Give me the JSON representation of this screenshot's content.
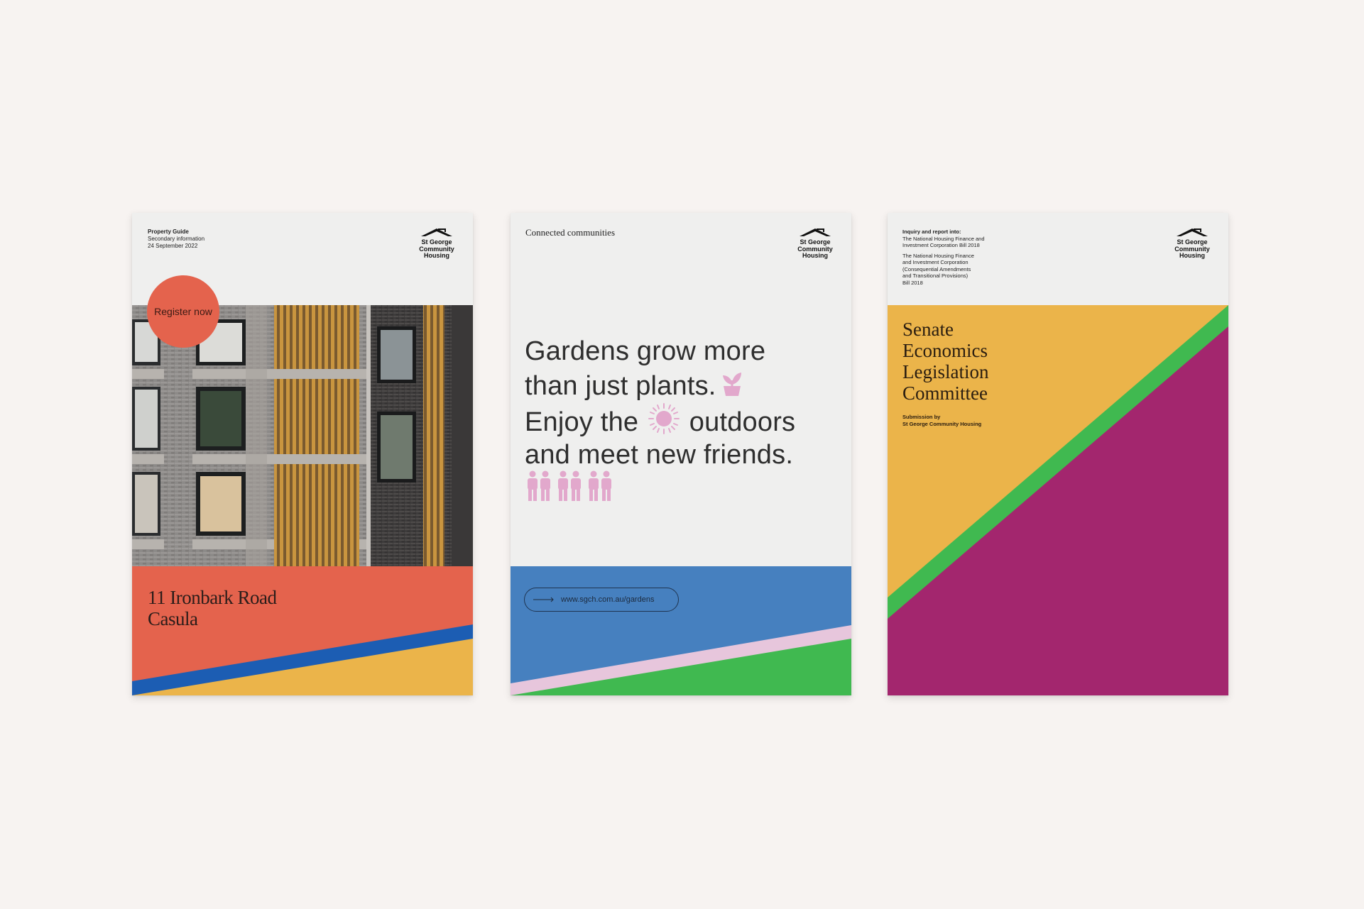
{
  "colors": {
    "background": "#f7f3f1",
    "paper": "#efefee",
    "coral": "#e4634d",
    "blue": "#1c5db3",
    "yellow": "#ebb44a",
    "sky_blue": "#4680bf",
    "pink": "#e7c6dc",
    "green": "#40b950",
    "magenta": "#a3266e",
    "pink_icon": "#e2a8cc"
  },
  "logo": {
    "icon": "house-roof-icon",
    "line1": "St George",
    "line2": "Community",
    "line3": "Housing"
  },
  "card1": {
    "meta_title": "Property Guide",
    "meta_subtitle": "Secondary information",
    "meta_date": "24 September 2022",
    "register_label": "Register now",
    "address_line1": "11 Ironbark Road",
    "address_line2": "Casula"
  },
  "card2": {
    "tag": "Connected communities",
    "headline_line1": "Gardens grow more",
    "headline_line2": "than just plants.",
    "headline_line3a": "Enjoy the",
    "headline_line3b": "outdoors",
    "headline_line4": "and meet new friends.",
    "url": "www.sgch.com.au/gardens",
    "icons": [
      "plant-icon",
      "sun-icon",
      "people-icon"
    ]
  },
  "card3": {
    "inquiry_heading": "Inquiry and report into:",
    "inquiry_bill1_line1": "The National Housing Finance and",
    "inquiry_bill1_line2": "Investment Corporation Bill 2018",
    "inquiry_bill2_line1": "The National Housing Finance",
    "inquiry_bill2_line2": "and Investment Corporation",
    "inquiry_bill2_line3": "(Consequential Amendments",
    "inquiry_bill2_line4": "and Transitional Provisions)",
    "inquiry_bill2_line5": "Bill 2018",
    "title_line1": "Senate",
    "title_line2": "Economics",
    "title_line3": "Legislation",
    "title_line4": "Committee",
    "submission_label": "Submission by",
    "submission_org": "St George Community Housing"
  }
}
